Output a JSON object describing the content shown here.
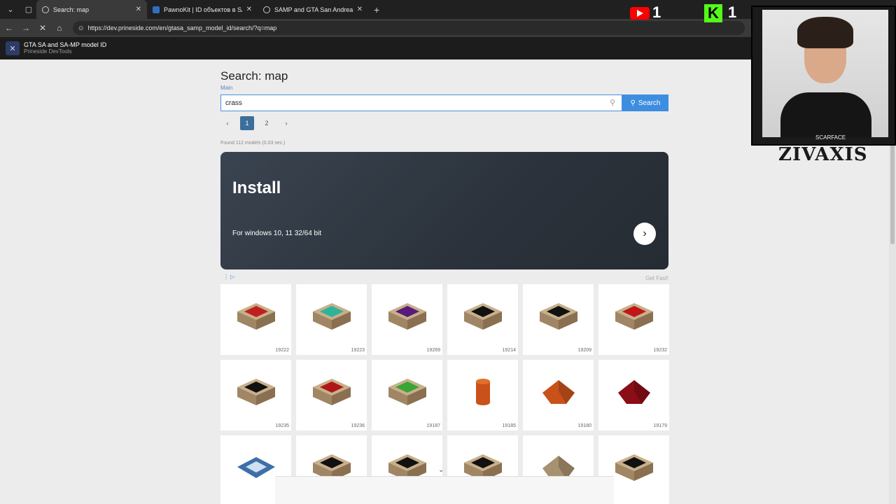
{
  "browser": {
    "tabs": [
      {
        "label": "Search: map",
        "active": true
      },
      {
        "label": "PawnoKit | ID объектов в SAMP",
        "active": false
      },
      {
        "label": "SAMP and GTA San Andreas textur",
        "active": false
      }
    ],
    "url": "https://dev.prineside.com/en/gtasa_samp_model_id/search/?q=map",
    "new_tab_symbol": "+"
  },
  "site": {
    "title": "GTA SA and SA-MP model ID",
    "subtitle": "Prineside DevTools"
  },
  "page": {
    "title": "Search: map",
    "breadcrumb": "Main",
    "search_value": "crass",
    "search_button": "Search",
    "pagination": [
      "1",
      "2"
    ],
    "current_page": "1",
    "found_text": "Found 112 models (0.03 sec.)"
  },
  "ad": {
    "title": "Install",
    "subtitle": "For windows 10, 11 32/64 bit",
    "side_text": "Get Fast!"
  },
  "models": [
    {
      "id": "19222",
      "color": "#c02020",
      "shape": "cube"
    },
    {
      "id": "19223",
      "color": "#2fb29a",
      "shape": "cube"
    },
    {
      "id": "19269",
      "color": "#5a1a7a",
      "shape": "cube"
    },
    {
      "id": "19214",
      "color": "#111111",
      "shape": "cube"
    },
    {
      "id": "19209",
      "color": "#111111",
      "shape": "cube"
    },
    {
      "id": "19232",
      "color": "#c01818",
      "shape": "cube"
    },
    {
      "id": "19235",
      "color": "#111111",
      "shape": "cube"
    },
    {
      "id": "19236",
      "color": "#b01818",
      "shape": "cube"
    },
    {
      "id": "19187",
      "color": "#39a537",
      "shape": "cube"
    },
    {
      "id": "19185",
      "color": "#c9521a",
      "shape": "cylinder"
    },
    {
      "id": "19180",
      "color": "#c9521a",
      "shape": "pyramid"
    },
    {
      "id": "19179",
      "color": "#8b0d16",
      "shape": "pyramid"
    },
    {
      "id": "",
      "color": "#3d6fa8",
      "shape": "flat"
    },
    {
      "id": "",
      "color": "#111111",
      "shape": "cube"
    },
    {
      "id": "",
      "color": "#111111",
      "shape": "cube"
    },
    {
      "id": "",
      "color": "#111111",
      "shape": "cube"
    },
    {
      "id": "",
      "color": "#a89170",
      "shape": "pyramid"
    },
    {
      "id": "",
      "color": "#111111",
      "shape": "cube"
    }
  ],
  "overlay": {
    "youtube_count": "1",
    "kick_count": "1",
    "kick_letter": "K",
    "streamer_name": "ZIVAXIS",
    "shirt_text": "SCARFACE"
  }
}
